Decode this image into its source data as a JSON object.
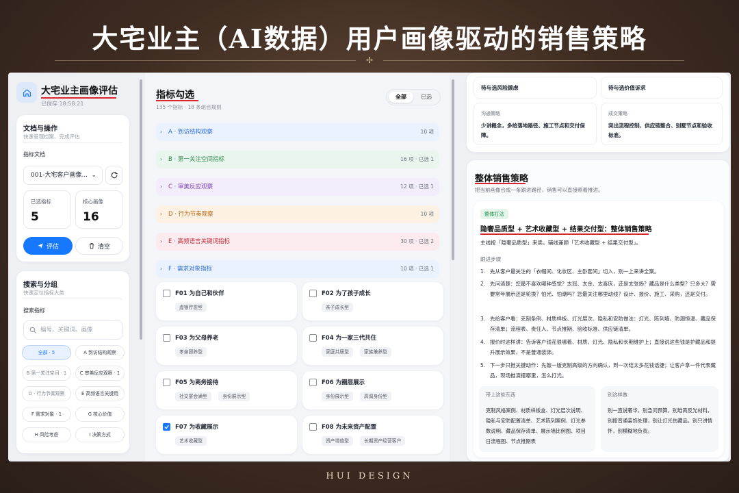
{
  "banner": {
    "title": "大宅业主（AI数据）用户画像驱动的销售策略",
    "footer": "HUI DESIGN"
  },
  "sidebar": {
    "app_title": "大宅业主画像评估",
    "saved_time": "已保存 18:58:21",
    "docs_card": {
      "title": "文档与操作",
      "subtitle": "快速管理档案、完成评估",
      "doc_label": "指标文档",
      "doc_selected": "001-大宅客户画像...",
      "selected_label": "已选指标",
      "selected_value": "5",
      "core_label": "核心画像",
      "core_value": "16",
      "evaluate_label": "评估",
      "clear_label": "清空"
    },
    "search_card": {
      "title": "搜索与分组",
      "subtitle": "快速定位指标大类",
      "search_label": "搜索指标",
      "search_placeholder": "编号、关键词、画像",
      "chips": [
        "全部 · 5",
        "A 到访结构观察",
        "B 第一关注空间 · 1",
        "C 审美反应观察 · 1",
        "D · 行为节奏观察",
        "E 高频语言关键用",
        "F 需求对象 · 1",
        "G 核心价值",
        "H 风险考虑",
        "I 决策方式"
      ]
    }
  },
  "indicators": {
    "title": "指标勾选",
    "subtitle": "135 个指标 · 18 条组合规则",
    "filter_all": "全部",
    "filter_selected": "已选",
    "groups": [
      {
        "label": "A · 到访结构观察",
        "meta": "10 项",
        "color": "#2f6fd6",
        "bg": "#eaf2ff"
      },
      {
        "label": "B · 第一关注空间指标",
        "meta": "16 项 · 已选 1",
        "color": "#2f8a4e",
        "bg": "#e9f6ee"
      },
      {
        "label": "C · 审美反应观察",
        "meta": "12 项 · 已选 1",
        "color": "#7b3fb0",
        "bg": "#f3ecfa"
      },
      {
        "label": "D · 行为节奏观察",
        "meta": "10 项",
        "color": "#b86a17",
        "bg": "#fcf1e3"
      },
      {
        "label": "E · 高频语言关键词指标",
        "meta": "30 项 · 已选 2",
        "color": "#c02a3a",
        "bg": "#fcebee"
      },
      {
        "label": "F · 需求对象指标",
        "meta": "10 项 · 已选 1",
        "color": "#2f6fd6",
        "bg": "#eaf2ff"
      }
    ],
    "items": [
      {
        "name": "F01 为自己和伙伴",
        "tags": [
          "虚银疗愈型"
        ],
        "checked": false
      },
      {
        "name": "F02 为了孩子成长",
        "tags": [
          "亲子成长型"
        ],
        "checked": false
      },
      {
        "name": "F03 为父母养老",
        "tags": [
          "孝亲颐养型"
        ],
        "checked": false
      },
      {
        "name": "F04 为一家三代共住",
        "tags": [
          "家庭共居型",
          "家族兼养型"
        ],
        "checked": false
      },
      {
        "name": "F05 为商务接待",
        "tags": [
          "社交宴会满型",
          "身份展示型"
        ],
        "checked": false
      },
      {
        "name": "F06 为圈层展示",
        "tags": [
          "身份展示型",
          "高调身份型"
        ],
        "checked": false
      },
      {
        "name": "F07 为收藏展示",
        "tags": [
          "艺术收藏型"
        ],
        "checked": true
      },
      {
        "name": "F08 为未来资产配置",
        "tags": [
          "资产增值型",
          "长期资产经营客户"
        ],
        "checked": false
      }
    ]
  },
  "strategy": {
    "top_cards": {
      "risk_title": "待与选风险顾虑",
      "value_title": "待与选价值诉求",
      "comm_label": "沟通策略",
      "comm_text": "少讲概念，多给落地路径、施工节点和交付保障。",
      "deal_label": "成交策略",
      "deal_text": "突出流程控制、供应链整合、别墅节点和验收标准。"
    },
    "title": "整体销售策略",
    "subtitle": "把当前画像合成一条跟进路径，销售可以直接照着推进。",
    "badge": "整体打法",
    "plan_title": "隐奢品质型 + 艺术收藏型 + 结果交付型：整体销售策略",
    "plan_lead": "主线按「隐奢品质型」来卖，辅线兼顾「艺术收藏型 + 结果交付型」。",
    "steps_label": "跟进步骤",
    "steps": [
      "先从客户最关注的「衣帽间、化妆区、主卧套间」切入，别一上来讲全案。",
      "先问清楚：您最不喜欢哪种感觉？太冠、太金、太喜庆，还是太张扬？藏品是什么类型？只多大？需要常年展示还是轮换？怕光、怕潮吗？您最关注哪里动线？设计、报价、施工、采购，还是交付。",
      "先给客户看：克制条例、材质样板、灯光层次、隐私和安防做法：灯光、陈列墙、防潮恒温、藏品保存清单；流程表、责任人、节点推期、验收标准、供应链清单。",
      "报价时这样讲：告诉客户钱花很哪着、材质、灯光、隐私和长期维护上；直接说这些钱是护藏品和提升展示效果，不是普通装饰。",
      "下一步只推关键动作：先敲一版克制高级的方向确认，到一次结太多花钱话捷；让客户拿一件代表藏品，现场推演摆哪里，怎么打光。"
    ],
    "bring_label": "带上这些东西",
    "bring_text": "克制风格案例、材质样板盒、灯光层次说明、隐私与安防配置清单、艺术陈列案例、灯光参数说明、藏品保存清单、展示墙比例图、项目日流程图、节点推期表",
    "avoid_label": "别这样做",
    "avoid_text": "别一直说奢华，别急问预算，别堆高反光材料，别按普通装饰处理，别让灯光伤藏品。别只讲情怀，别模糊地负责。"
  }
}
